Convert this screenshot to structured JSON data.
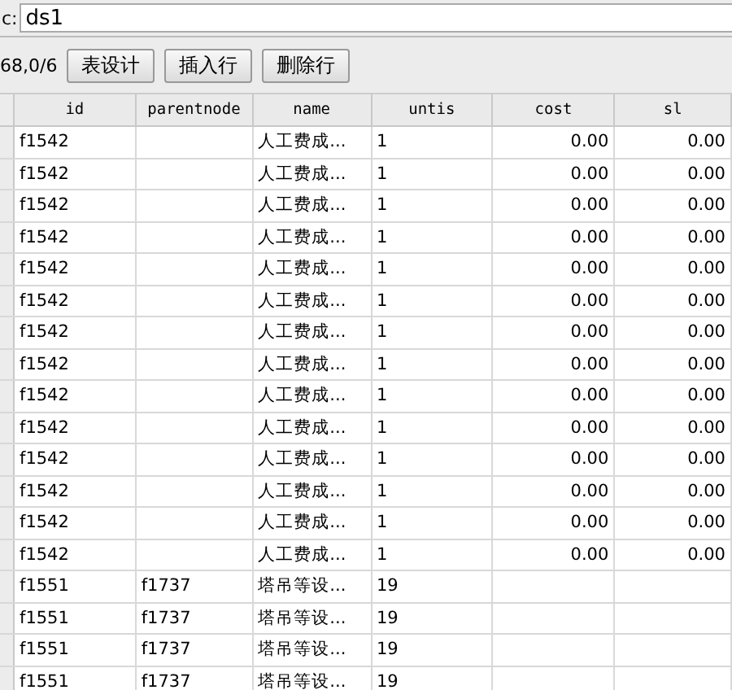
{
  "source": {
    "label": "c:",
    "value": "ds1"
  },
  "toolbar": {
    "status": "68,0/6",
    "buttons": [
      "表设计",
      "插入行",
      "删除行"
    ]
  },
  "table": {
    "columns": [
      "id",
      "parentnode",
      "name",
      "untis",
      "cost",
      "sl"
    ],
    "rows": [
      {
        "cells": [
          "f1542",
          "",
          "人工费成...",
          "1",
          "0.00",
          "0.00"
        ]
      },
      {
        "cells": [
          "f1542",
          "",
          "人工费成...",
          "1",
          "0.00",
          "0.00"
        ]
      },
      {
        "cells": [
          "f1542",
          "",
          "人工费成...",
          "1",
          "0.00",
          "0.00"
        ]
      },
      {
        "cells": [
          "f1542",
          "",
          "人工费成...",
          "1",
          "0.00",
          "0.00"
        ]
      },
      {
        "cells": [
          "f1542",
          "",
          "人工费成...",
          "1",
          "0.00",
          "0.00"
        ]
      },
      {
        "cells": [
          "f1542",
          "",
          "人工费成...",
          "1",
          "0.00",
          "0.00"
        ]
      },
      {
        "cells": [
          "f1542",
          "",
          "人工费成...",
          "1",
          "0.00",
          "0.00"
        ]
      },
      {
        "cells": [
          "f1542",
          "",
          "人工费成...",
          "1",
          "0.00",
          "0.00"
        ]
      },
      {
        "cells": [
          "f1542",
          "",
          "人工费成...",
          "1",
          "0.00",
          "0.00"
        ]
      },
      {
        "cells": [
          "f1542",
          "",
          "人工费成...",
          "1",
          "0.00",
          "0.00"
        ]
      },
      {
        "cells": [
          "f1542",
          "",
          "人工费成...",
          "1",
          "0.00",
          "0.00"
        ]
      },
      {
        "cells": [
          "f1542",
          "",
          "人工费成...",
          "1",
          "0.00",
          "0.00"
        ]
      },
      {
        "cells": [
          "f1542",
          "",
          "人工费成...",
          "1",
          "0.00",
          "0.00"
        ]
      },
      {
        "cells": [
          "f1542",
          "",
          "人工费成...",
          "1",
          "0.00",
          "0.00"
        ]
      },
      {
        "cells": [
          "f1551",
          "f1737",
          "塔吊等设...",
          "19"
        ]
      },
      {
        "cells": [
          "f1551",
          "f1737",
          "塔吊等设...",
          "19"
        ]
      },
      {
        "cells": [
          "f1551",
          "f1737",
          "塔吊等设...",
          "19"
        ]
      },
      {
        "cells": [
          "f1551",
          "f1737",
          "塔吊等设...",
          "19"
        ]
      }
    ]
  }
}
